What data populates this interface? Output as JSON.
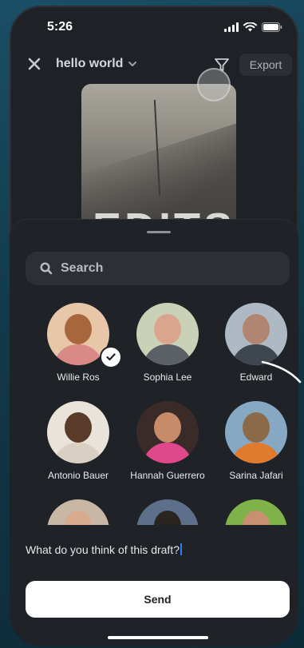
{
  "status": {
    "time": "5:26"
  },
  "header": {
    "title": "hello world",
    "export_label": "Export"
  },
  "preview": {
    "overlay_text": "EDITS"
  },
  "search": {
    "placeholder": "Search"
  },
  "contacts": [
    {
      "name": "Willie Ros",
      "selected": true,
      "bg": "#e8c7a8",
      "head": "#a8663d",
      "body": "#d98a86"
    },
    {
      "name": "Sophia Lee",
      "selected": false,
      "bg": "#c9d2b6",
      "head": "#d9a58c",
      "body": "#5b5f66"
    },
    {
      "name": "Edward",
      "selected": false,
      "bg": "#aeb9c4",
      "head": "#b08572",
      "body": "#3e4650"
    },
    {
      "name": "Antonio Bauer",
      "selected": false,
      "bg": "#e9e3da",
      "head": "#5a3a28",
      "body": "#d9cfc2"
    },
    {
      "name": "Hannah Guerrero",
      "selected": false,
      "bg": "#3a2a28",
      "head": "#c68c6a",
      "body": "#e0488c"
    },
    {
      "name": "Sarina Jafari",
      "selected": false,
      "bg": "#86a8c2",
      "head": "#8b6a4a",
      "body": "#e07a2c"
    },
    {
      "name": "",
      "selected": false,
      "bg": "#c9b7a6",
      "head": "#d8aa8e",
      "body": "#6a5a4e"
    },
    {
      "name": "",
      "selected": false,
      "bg": "#5d6f8a",
      "head": "#2b2522",
      "body": "#2e3138"
    },
    {
      "name": "",
      "selected": false,
      "bg": "#7fb34a",
      "head": "#c79070",
      "body": "#5a8a3a"
    }
  ],
  "message": {
    "text": "What do you think of this draft?"
  },
  "send": {
    "label": "Send"
  },
  "colors": {
    "background": "#1e2125",
    "accent_cursor": "#2f7df6",
    "button_bg": "#ffffff"
  }
}
